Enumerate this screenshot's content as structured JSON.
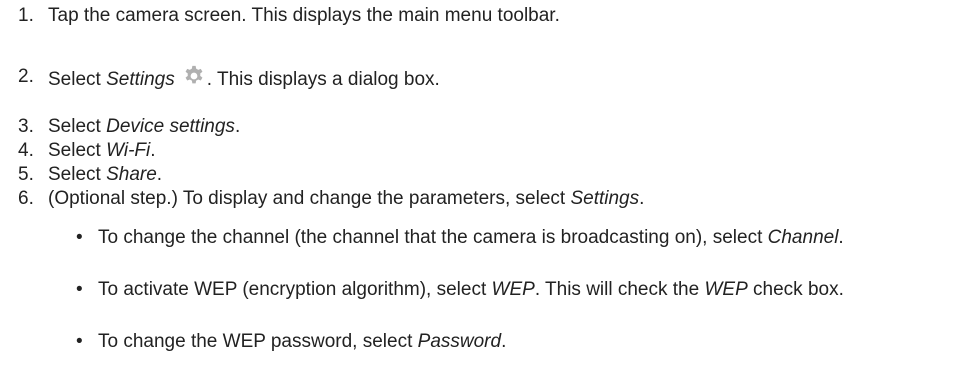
{
  "steps": [
    {
      "num": "1.",
      "text": "Tap the camera screen. This displays the main menu toolbar."
    },
    {
      "num": "2.",
      "pre": "Select ",
      "em": "Settings",
      "post": ". This displays a dialog box.",
      "icon": "gear-icon"
    },
    {
      "num": "3.",
      "pre": "Select ",
      "em": "Device settings",
      "post": "."
    },
    {
      "num": "4.",
      "pre": "Select ",
      "em": "Wi-Fi",
      "post": "."
    },
    {
      "num": "5.",
      "pre": "Select ",
      "em": "Share",
      "post": "."
    },
    {
      "num": "6.",
      "pre": "(Optional step.) To display and change the parameters, select ",
      "em": "Settings",
      "post": "."
    }
  ],
  "bullets": [
    {
      "pre": "To change the channel (the channel that the camera is broadcasting on), select ",
      "em": "Channel",
      "post": "."
    },
    {
      "pre": "To activate WEP (encryption algorithm), select ",
      "em": "WEP",
      "mid": ". This will check the ",
      "em2": "WEP",
      "post": " check box."
    },
    {
      "pre": "To change the WEP password, select ",
      "em": "Password",
      "post": "."
    }
  ],
  "bullet_glyph": "•",
  "colors": {
    "text": "#222222",
    "icon": "#b0b0b0"
  }
}
